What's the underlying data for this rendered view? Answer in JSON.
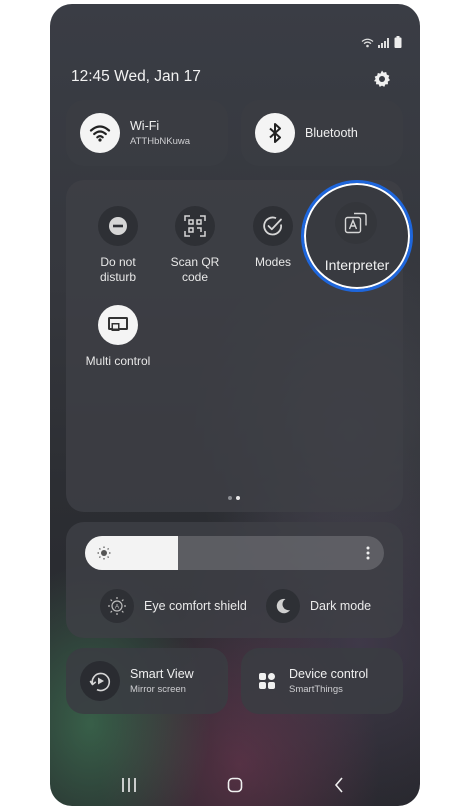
{
  "clock": {
    "text": "12:45 Wed, Jan 17"
  },
  "status_icons": [
    "wifi-icon",
    "signal-icon",
    "battery-icon"
  ],
  "tiles": {
    "wifi": {
      "title": "Wi-Fi",
      "subtitle": "ATTHbNKuwa",
      "icon": "wifi-icon",
      "state": "on"
    },
    "bluetooth": {
      "title": "Bluetooth",
      "icon": "bluetooth-icon",
      "state": "on"
    }
  },
  "quick_settings": [
    {
      "label": "Do not\ndisturb",
      "icon": "minus-circle-icon"
    },
    {
      "label": "Scan QR\ncode",
      "icon": "qr-scan-icon"
    },
    {
      "label": "Modes",
      "icon": "check-circle-icon"
    },
    {
      "label": "Interpreter",
      "icon": "translate-icon",
      "highlighted": true
    },
    {
      "label": "Multi control",
      "icon": "multi-control-icon"
    }
  ],
  "page_indicator": {
    "pages": 2,
    "current": 2
  },
  "brightness": {
    "level": 0.31,
    "icon": "sun-icon"
  },
  "display_options": [
    {
      "label": "Eye comfort shield",
      "icon": "eye-comfort-icon"
    },
    {
      "label": "Dark mode",
      "icon": "moon-icon"
    }
  ],
  "bottom_tiles": {
    "smart_view": {
      "title": "Smart View",
      "subtitle": "Mirror screen",
      "icon": "smart-view-icon"
    },
    "device_control": {
      "title": "Device control",
      "subtitle": "SmartThings",
      "icon": "device-control-icon"
    }
  },
  "nav": [
    "recents-icon",
    "home-icon",
    "back-icon"
  ],
  "colors": {
    "highlight_ring": "#1e66dc",
    "tile_active": "#f4f4f4"
  }
}
